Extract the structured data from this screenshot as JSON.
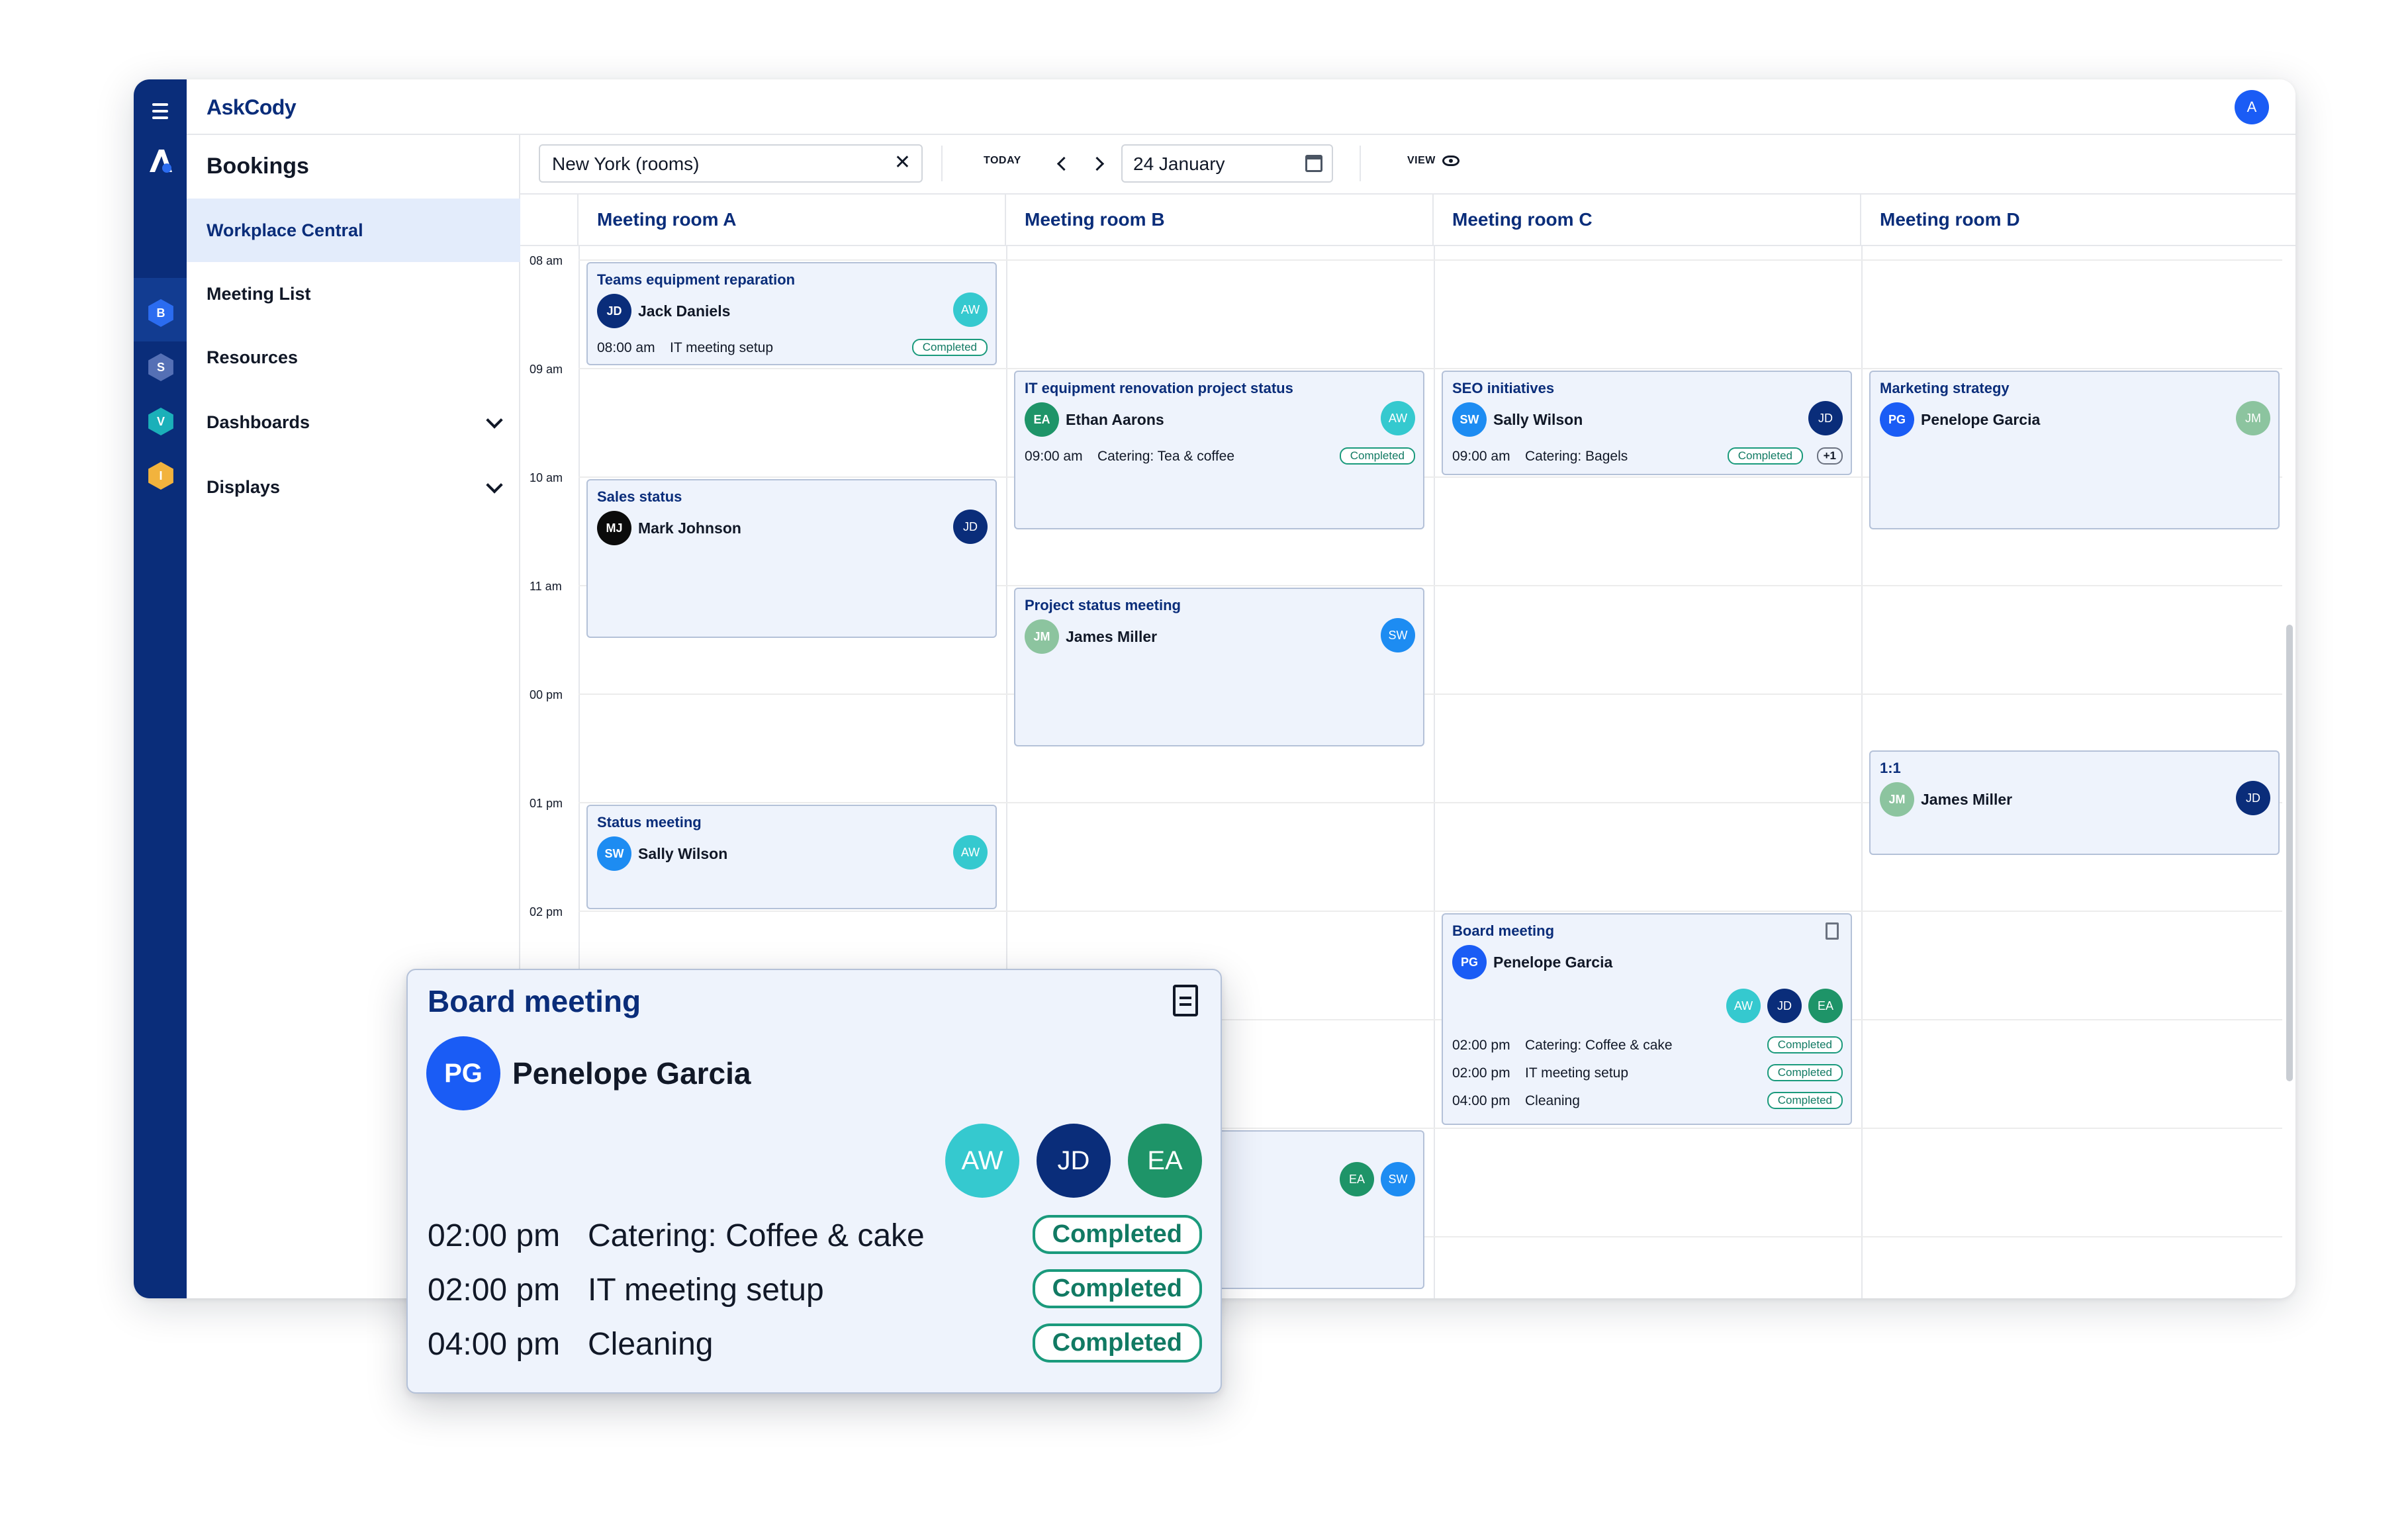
{
  "app": {
    "brand": "AskCody",
    "user_initial": "A"
  },
  "rail": {
    "items": [
      "B",
      "S",
      "V",
      "I"
    ]
  },
  "sidebar": {
    "title": "Bookings",
    "items": [
      {
        "label": "Workplace Central"
      },
      {
        "label": "Meeting List"
      },
      {
        "label": "Resources"
      },
      {
        "label": "Dashboards"
      },
      {
        "label": "Displays"
      }
    ]
  },
  "toolbar": {
    "location": "New York (rooms)",
    "clear": "✕",
    "today_label": "TODAY",
    "date": "24 January",
    "view_label": "VIEW"
  },
  "calendar": {
    "rooms": [
      "Meeting room A",
      "Meeting room B",
      "Meeting room C",
      "Meeting room D"
    ],
    "times": [
      "08 am",
      "09 am",
      "10 am",
      "11 am",
      "00 pm",
      "01 pm",
      "02 pm"
    ]
  },
  "colors": {
    "navy": "#0a2d7a",
    "blue": "#1a5cf5",
    "teal": "#35c9cf",
    "green": "#1e9468",
    "sage": "#8cc49f",
    "black": "#0b0b0b",
    "sky": "#1d8cf2"
  },
  "bookings": {
    "teams": {
      "title": "Teams equipment reparation",
      "host": "Jack Daniels",
      "host_initials": "JD",
      "guest": "AW",
      "time": "08:00 am",
      "service": "IT meeting setup",
      "status": "Completed"
    },
    "sales": {
      "title": "Sales status",
      "host": "Mark Johnson",
      "host_initials": "MJ",
      "guest": "JD"
    },
    "status_mtg": {
      "title": "Status meeting",
      "host": "Sally Wilson",
      "host_initials": "SW",
      "guest": "AW"
    },
    "it_equip": {
      "title": "IT equipment renovation project status",
      "host": "Ethan Aarons",
      "host_initials": "EA",
      "guest": "AW",
      "time": "09:00 am",
      "service": "Catering: Tea & coffee",
      "status": "Completed"
    },
    "project": {
      "title": "Project status meeting",
      "host": "James Miller",
      "host_initials": "JM",
      "guest": "SW"
    },
    "hidden_b": {
      "guest1": "EA",
      "guest2": "SW"
    },
    "seo": {
      "title": "SEO initiatives",
      "host": "Sally Wilson",
      "host_initials": "SW",
      "guest": "JD",
      "time": "09:00 am",
      "service": "Catering: Bagels",
      "status": "Completed",
      "more": "+1"
    },
    "board_small": {
      "title": "Board meeting",
      "host": "Penelope Garcia",
      "host_initials": "PG",
      "guests": [
        "AW",
        "JD",
        "EA"
      ],
      "rows": [
        {
          "time": "02:00 pm",
          "service": "Catering: Coffee & cake",
          "status": "Completed"
        },
        {
          "time": "02:00 pm",
          "service": "IT meeting setup",
          "status": "Completed"
        },
        {
          "time": "04:00 pm",
          "service": "Cleaning",
          "status": "Completed"
        }
      ]
    },
    "marketing": {
      "title": "Marketing strategy",
      "host": "Penelope Garcia",
      "host_initials": "PG",
      "guest": "JM"
    },
    "one_on_one": {
      "title": "1:1",
      "host": "James Miller",
      "host_initials": "JM",
      "guest": "JD"
    }
  },
  "popup": {
    "title": "Board meeting",
    "host": "Penelope Garcia",
    "host_initials": "PG",
    "guests": [
      "AW",
      "JD",
      "EA"
    ],
    "rows": [
      {
        "time": "02:00 pm",
        "service": "Catering: Coffee & cake",
        "status": "Completed"
      },
      {
        "time": "02:00 pm",
        "service": "IT meeting setup",
        "status": "Completed"
      },
      {
        "time": "04:00 pm",
        "service": "Cleaning",
        "status": "Completed"
      }
    ]
  }
}
